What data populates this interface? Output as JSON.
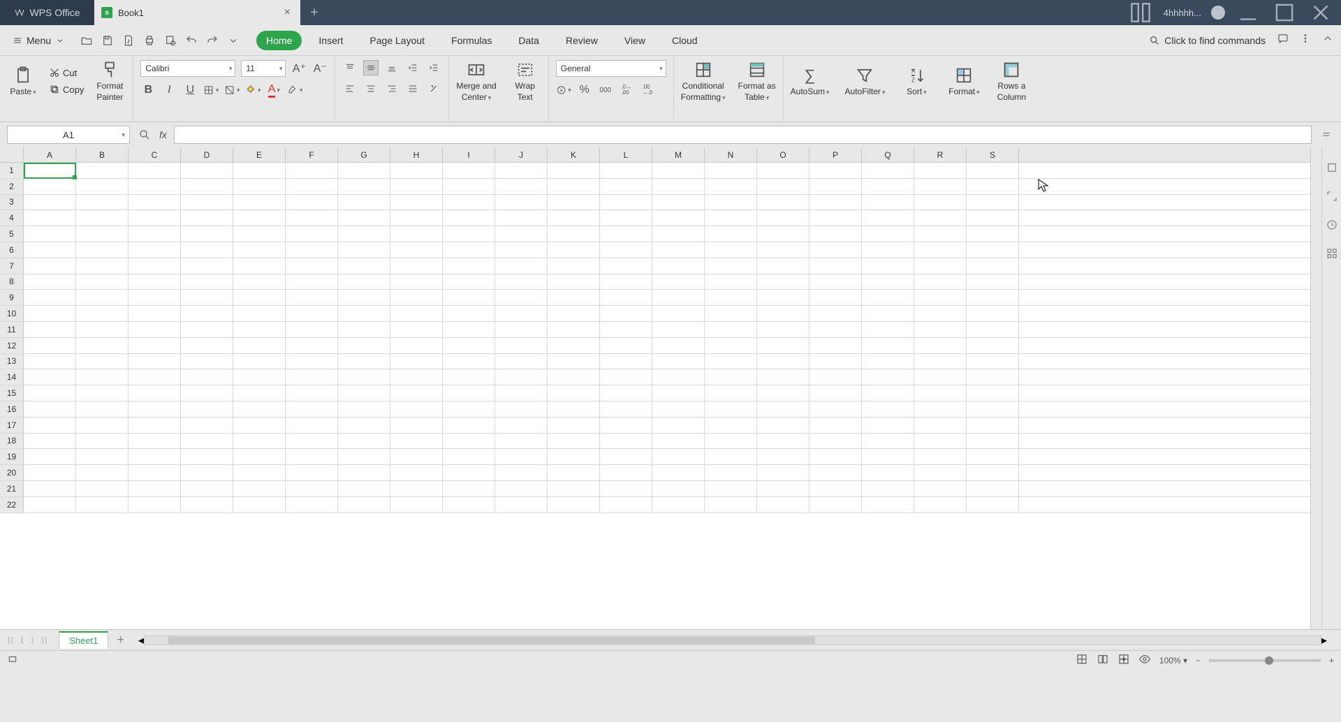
{
  "app": {
    "brand": "WPS Office",
    "username": "4hhhhh..."
  },
  "tab": {
    "title": "Book1"
  },
  "menu_button": "Menu",
  "ribbon_tabs": [
    "Home",
    "Insert",
    "Page Layout",
    "Formulas",
    "Data",
    "Review",
    "View",
    "Cloud"
  ],
  "active_ribbon_tab": 0,
  "find_commands": "Click to find commands",
  "clipboard": {
    "paste": "Paste",
    "cut": "Cut",
    "copy": "Copy",
    "format_painter_l1": "Format",
    "format_painter_l2": "Painter"
  },
  "font": {
    "name": "Calibri",
    "size": "11"
  },
  "number_format": "General",
  "merge_center": {
    "l1": "Merge and",
    "l2": "Center"
  },
  "wrap_text": {
    "l1": "Wrap",
    "l2": "Text"
  },
  "cond_fmt": {
    "l1": "Conditional",
    "l2": "Formatting"
  },
  "fmt_table": {
    "l1": "Format as",
    "l2": "Table"
  },
  "auto_sum": "AutoSum",
  "auto_filter": "AutoFilter",
  "sort": "Sort",
  "format": "Format",
  "rows_cols": {
    "l1": "Rows a",
    "l2": "Column"
  },
  "name_box": "A1",
  "fx": "fx",
  "columns": [
    "A",
    "B",
    "C",
    "D",
    "E",
    "F",
    "G",
    "H",
    "I",
    "J",
    "K",
    "L",
    "M",
    "N",
    "O",
    "P",
    "Q",
    "R",
    "S"
  ],
  "rows": [
    "1",
    "2",
    "3",
    "4",
    "5",
    "6",
    "7",
    "8",
    "9",
    "10",
    "11",
    "12",
    "13",
    "14",
    "15",
    "16",
    "17",
    "18",
    "19",
    "20",
    "21",
    "22"
  ],
  "sheet_tab": "Sheet1",
  "zoom": "100%"
}
